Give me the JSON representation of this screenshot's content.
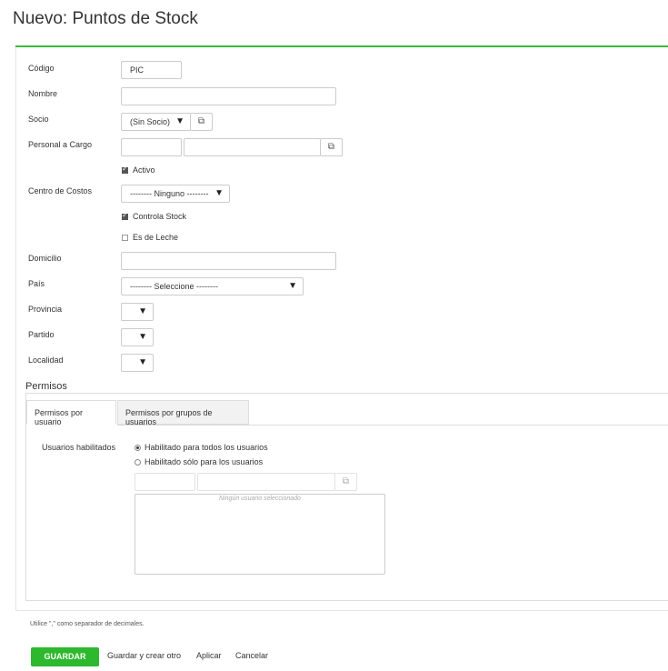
{
  "page": {
    "title": "Nuevo: Puntos de Stock"
  },
  "form": {
    "codigo_label": "Código",
    "codigo_value": "PIC",
    "nombre_label": "Nombre",
    "nombre_value": "",
    "socio_label": "Socio",
    "socio_value": "(Sin Socio)",
    "personal_label": "Personal a Cargo",
    "activo_label": "Activo",
    "activo_checked": true,
    "centro_label": "Centro de Costos",
    "centro_value": "-------- Ninguno --------",
    "controla_label": "Controla Stock",
    "controla_checked": true,
    "leche_label": "Es de Leche",
    "leche_checked": false,
    "domicilio_label": "Domicilio",
    "pais_label": "País",
    "pais_value": "-------- Seleccione --------",
    "provincia_label": "Provincia",
    "partido_label": "Partido",
    "localidad_label": "Localidad"
  },
  "permisos": {
    "title": "Permisos",
    "tabs": [
      {
        "label": "Permisos por usuario",
        "active": true
      },
      {
        "label": "Permisos por grupos de usuarios",
        "active": false
      }
    ],
    "usuarios_label": "Usuarios habilitados",
    "radio_all": "Habilitado para todos los usuarios",
    "radio_some": "Habilitado sólo para los usuarios",
    "selected_radio": "all",
    "empty_text": "Ningún usuario seleccionado"
  },
  "footer": {
    "note": "Utilice \",\" como separador de decimales.",
    "save": "GUARDAR",
    "save_new": "Guardar y crear otro",
    "apply": "Aplicar",
    "cancel": "Cancelar"
  },
  "icons": {
    "dropdown": "▼",
    "external": "⧉"
  },
  "colors": {
    "accent": "#2eb82e",
    "topline": "#3db93d"
  }
}
